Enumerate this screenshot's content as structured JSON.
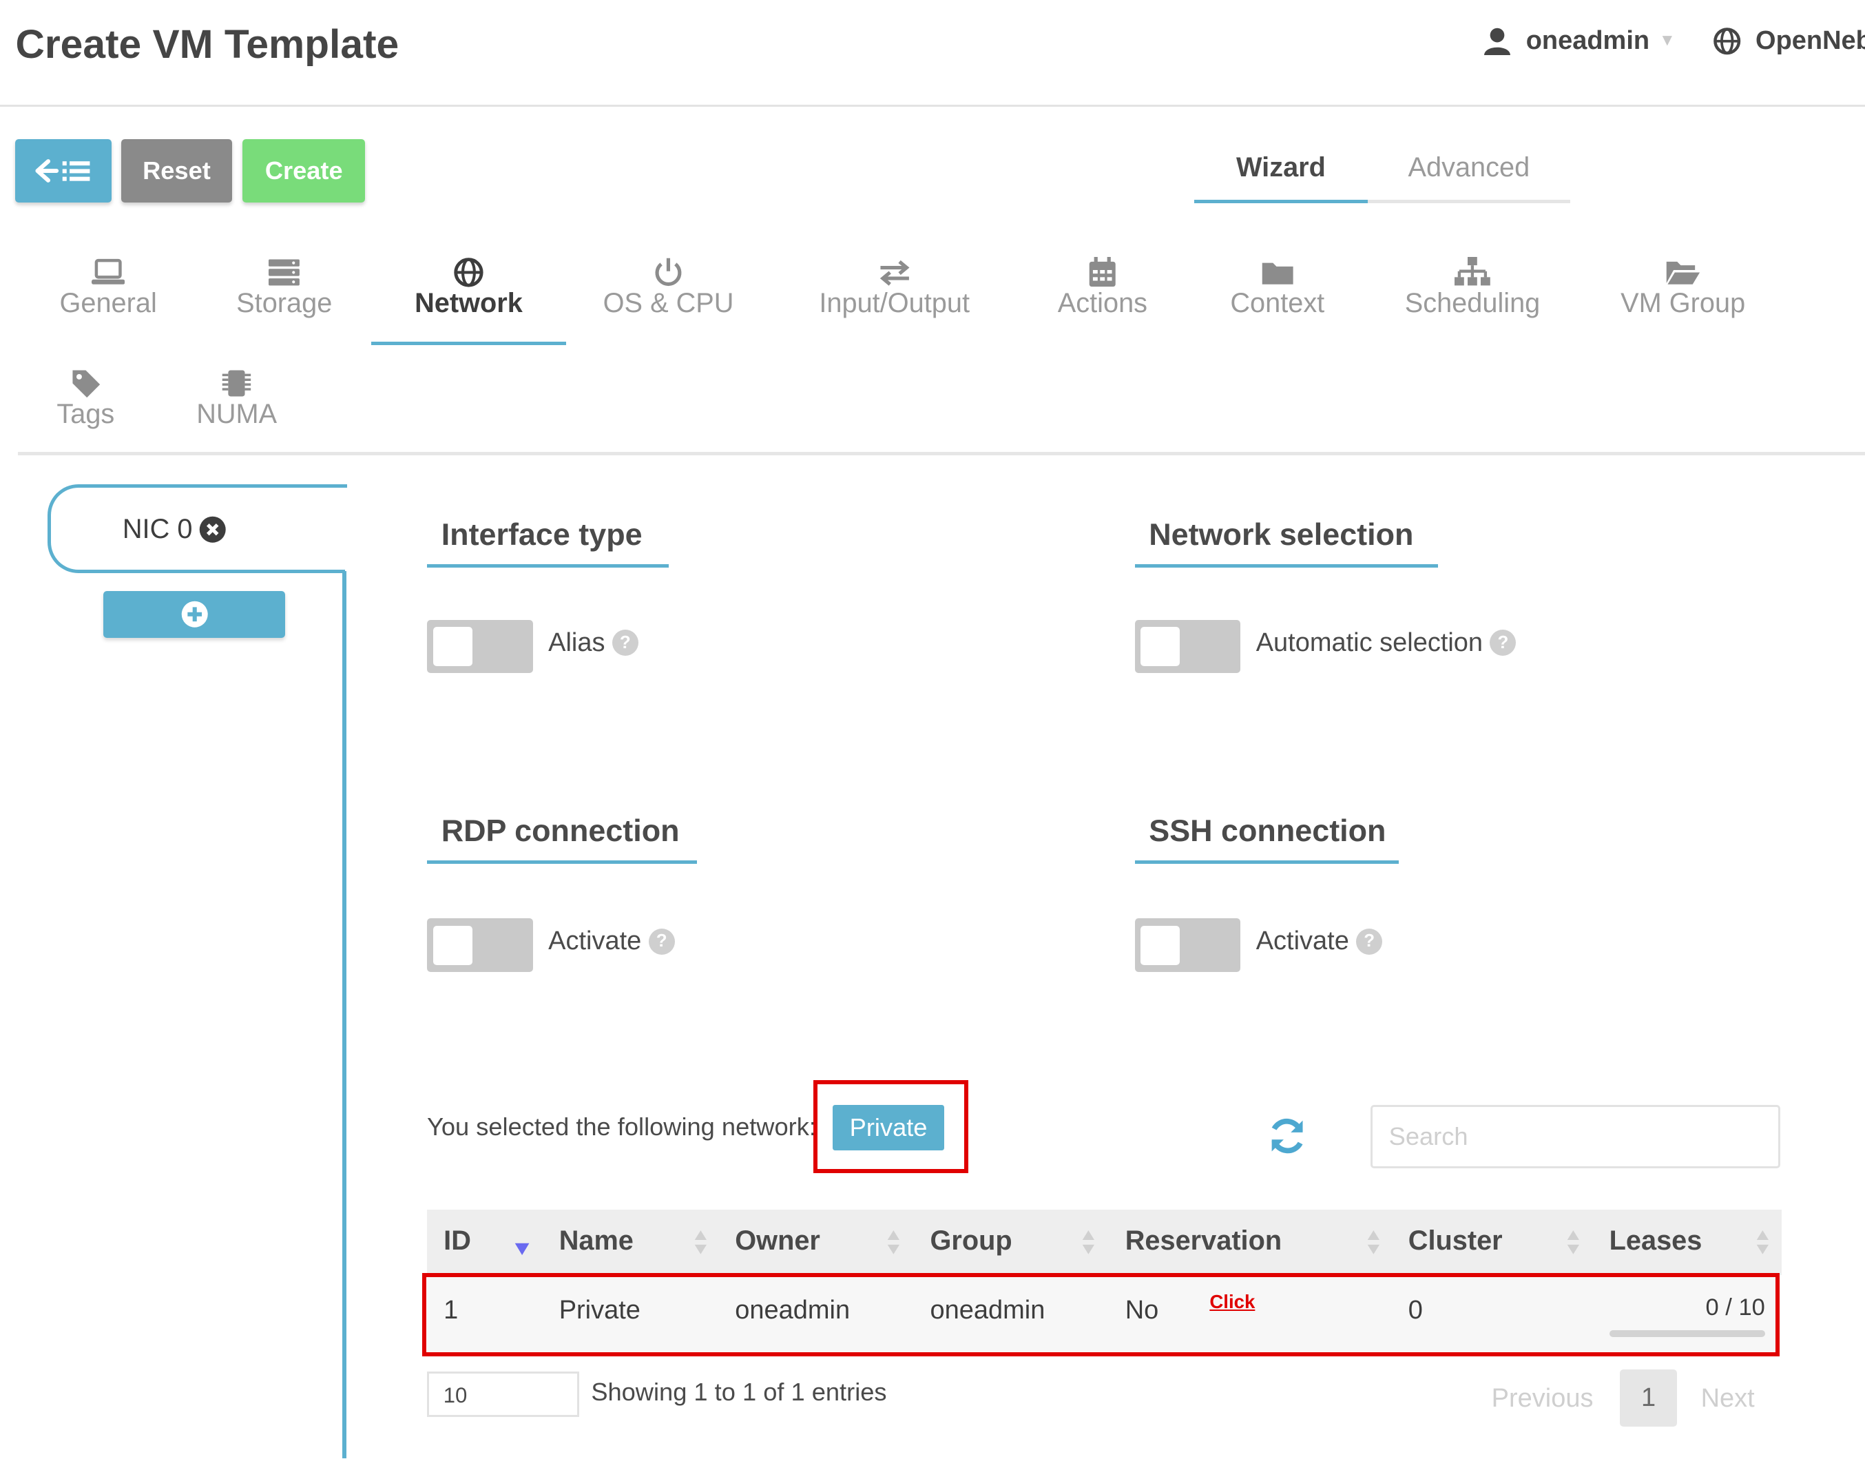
{
  "header": {
    "title": "Create VM Template",
    "user": "oneadmin",
    "zone": "OpenNebula"
  },
  "actions": {
    "back_icon": "back-list-icon",
    "reset_label": "Reset",
    "create_label": "Create"
  },
  "mode_tabs": {
    "wizard": "Wizard",
    "advanced": "Advanced",
    "active": "Wizard"
  },
  "section_tabs": [
    {
      "label": "General",
      "icon": "laptop-icon"
    },
    {
      "label": "Storage",
      "icon": "storage-icon"
    },
    {
      "label": "Network",
      "icon": "globe-icon"
    },
    {
      "label": "OS & CPU",
      "icon": "power-icon"
    },
    {
      "label": "Input/Output",
      "icon": "exchange-icon"
    },
    {
      "label": "Actions",
      "icon": "calendar-icon"
    },
    {
      "label": "Context",
      "icon": "folder-icon"
    },
    {
      "label": "Scheduling",
      "icon": "sitemap-icon"
    },
    {
      "label": "VM Group",
      "icon": "folder-open-icon"
    },
    {
      "label": "Tags",
      "icon": "tag-icon"
    },
    {
      "label": "NUMA",
      "icon": "chip-icon"
    }
  ],
  "active_section": "Network",
  "nic": {
    "label": "NIC 0"
  },
  "sections": {
    "interface_type": {
      "title": "Interface type",
      "toggle_label": "Alias",
      "enabled": false
    },
    "network_selection": {
      "title": "Network selection",
      "toggle_label": "Automatic selection",
      "enabled": false
    },
    "rdp": {
      "title": "RDP connection",
      "toggle_label": "Activate",
      "enabled": false
    },
    "ssh": {
      "title": "SSH connection",
      "toggle_label": "Activate",
      "enabled": false
    }
  },
  "selection": {
    "text": "You selected the following network:",
    "network": "Private"
  },
  "search": {
    "placeholder": "Search",
    "value": ""
  },
  "table": {
    "columns": [
      "ID",
      "Name",
      "Owner",
      "Group",
      "Reservation",
      "Cluster",
      "Leases"
    ],
    "rows": [
      {
        "id": "1",
        "name": "Private",
        "owner": "oneadmin",
        "group": "oneadmin",
        "reservation": "No",
        "cluster": "0",
        "leases": "0 / 10",
        "leases_used_fraction": 0
      }
    ],
    "annotation": "Click"
  },
  "footer": {
    "page_size": "10",
    "showing": "Showing 1 to 1 of 1 entries",
    "previous": "Previous",
    "current_page": "1",
    "next": "Next"
  },
  "colors": {
    "accent": "#5cb0cf",
    "create": "#79dc7a",
    "reset": "#8a8a8a",
    "highlight": "#e00000"
  }
}
